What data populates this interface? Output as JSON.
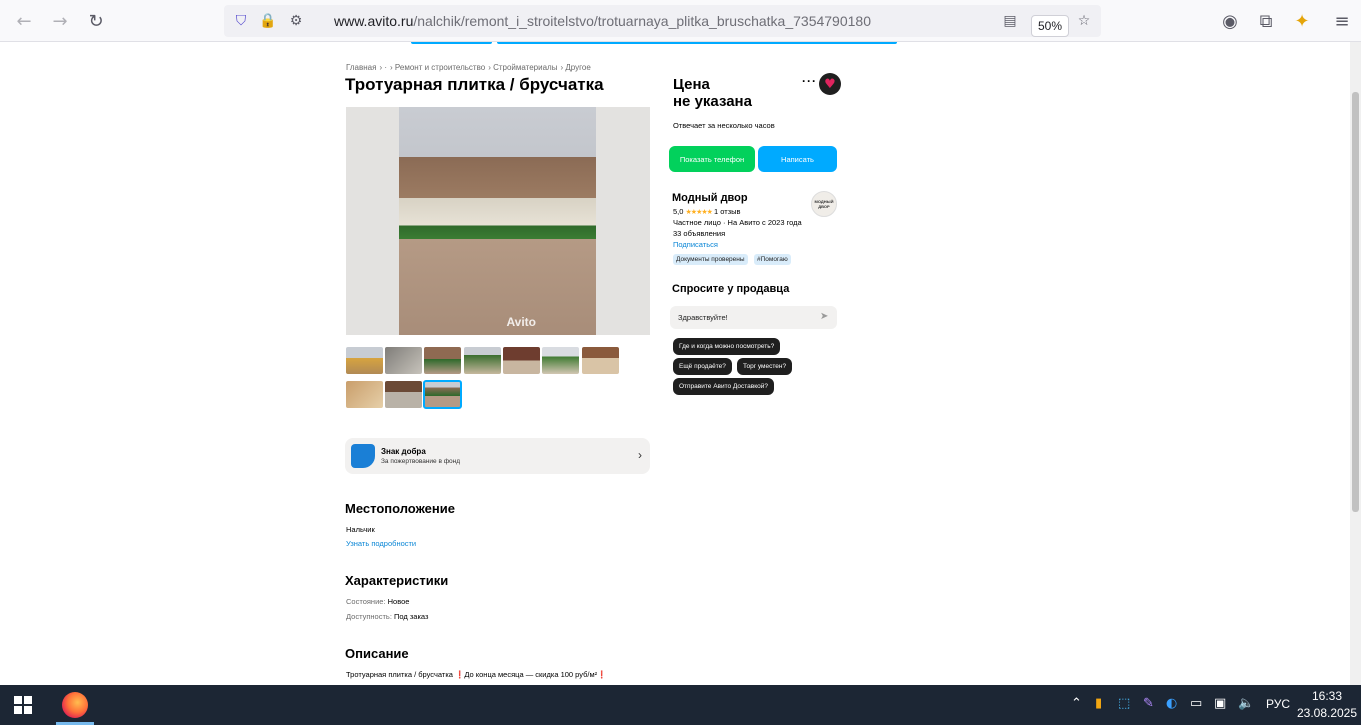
{
  "browser": {
    "url_domain": "www.avito.ru",
    "url_path": "/nalchik/remont_i_stroitelstvo/trotuarnaya_plitka_bruschatka_7354790180",
    "zoom": "50%"
  },
  "breadcrumbs": [
    "Главная",
    "·",
    "Ремонт и строительство",
    "Стройматериалы",
    "Другое"
  ],
  "listing": {
    "title": "Тротуарная плитка / брусчатка",
    "photo_watermark": "Avito"
  },
  "charity": {
    "title": "Знак добра",
    "subtitle": "За пожертвование в фонд"
  },
  "location": {
    "heading": "Местоположение",
    "city": "Нальчик",
    "details_link": "Узнать подробности"
  },
  "characteristics": {
    "heading": "Характеристики",
    "condition_label": "Состояние:",
    "condition_value": "Новое",
    "availability_label": "Доступность:",
    "availability_value": "Под заказ"
  },
  "description": {
    "heading": "Описание",
    "text": "Тротуарная плитка / брусчатка ❗До конца месяца — скидка 100 руб/м²❗"
  },
  "offer": {
    "price_line1": "Цена",
    "price_line2": "не указана",
    "reply_time": "Отвечает за несколько часов",
    "show_phone": "Показать телефон",
    "write": "Написать"
  },
  "seller": {
    "name": "Модный двор",
    "logo_text": "МОДНЫЙ ДВОР",
    "rating": "5,0",
    "reviews": "1 отзыв",
    "since": "Частное лицо · На Авито с 2023 года",
    "listings": "33 объявления",
    "subscribe": "Подписаться",
    "badges": [
      "Документы проверены",
      "#Помогаю"
    ]
  },
  "ask": {
    "heading": "Спросите у продавца",
    "input_value": "Здравствуйте!",
    "chips": [
      "Где и когда можно посмотреть?",
      "Ещё продаёте?",
      "Торг уместен?",
      "Отправите Авито Доставкой?"
    ]
  },
  "taskbar": {
    "language": "РУС",
    "time": "16:33",
    "date": "23.08.2025"
  }
}
